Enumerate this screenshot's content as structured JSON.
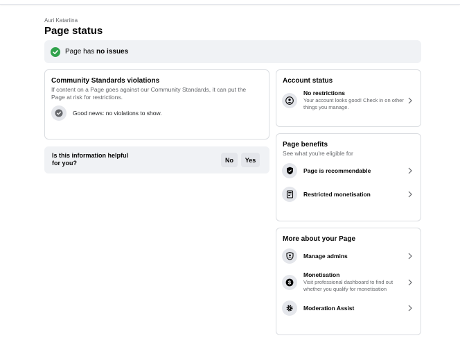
{
  "header": {
    "owner": "Auri Katariina",
    "title": "Page status"
  },
  "status": {
    "prefix": "Page has ",
    "emphasis": "no issues",
    "color": "#31a24c"
  },
  "community": {
    "title": "Community Standards violations",
    "description": "If content on a Page goes against our Community Standards, it can put the Page at risk for restrictions.",
    "good_news": "Good news: no violations to show."
  },
  "feedback": {
    "question": "Is this information helpful for you?",
    "no_label": "No",
    "yes_label": "Yes"
  },
  "account_status": {
    "title": "Account status",
    "item_title": "No restrictions",
    "item_sub": "Your account looks good! Check in on other things you manage."
  },
  "page_benefits": {
    "title": "Page benefits",
    "subtitle": "See what you're eligible for",
    "items": [
      {
        "label": "Page is recommendable",
        "icon": "shield-check-icon"
      },
      {
        "label": "Restricted monetisation",
        "icon": "money-doc-icon"
      }
    ]
  },
  "more_about": {
    "title": "More about your Page",
    "items": [
      {
        "label": "Manage admins",
        "sub": "",
        "icon": "admin-shield-icon"
      },
      {
        "label": "Monetisation",
        "sub": "Visit professional dashboard to find out whether you qualify for monetisation",
        "icon": "dollar-icon"
      },
      {
        "label": "Moderation Assist",
        "sub": "",
        "icon": "gear-icon"
      }
    ]
  }
}
